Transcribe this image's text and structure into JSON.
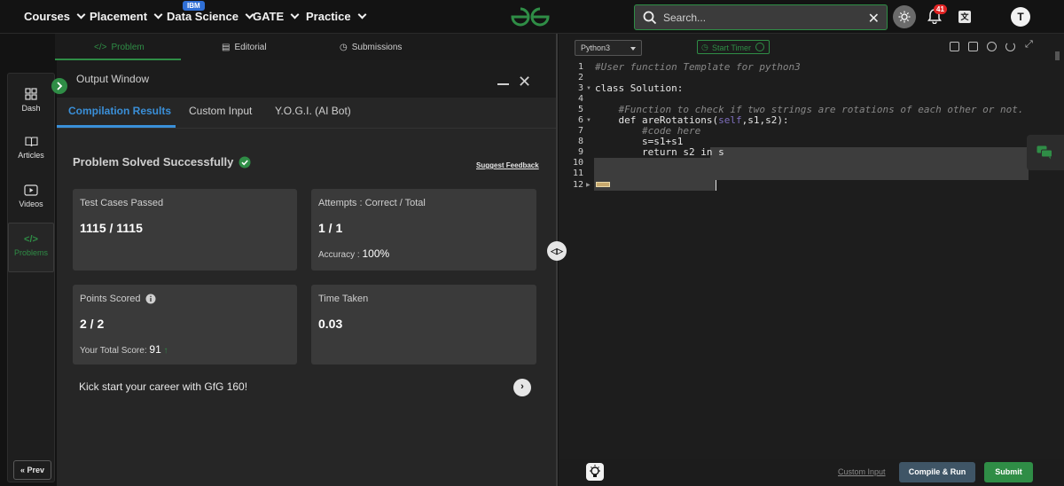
{
  "nav": {
    "courses": "Courses",
    "placement": "Placement",
    "data_science": "Data Science",
    "ibm_badge": "IBM",
    "gate": "GATE",
    "practice": "Practice"
  },
  "search": {
    "placeholder": "Search..."
  },
  "notifications": {
    "count": "41"
  },
  "user": {
    "initial": "T"
  },
  "problem_tabs": {
    "problem": "Problem",
    "editorial": "Editorial",
    "submissions": "Submissions"
  },
  "sidebar": {
    "dash": "Dash",
    "articles": "Articles",
    "videos": "Videos",
    "problems": "Problems",
    "prev": "Prev"
  },
  "output": {
    "title": "Output Window",
    "tabs": [
      "Compilation Results",
      "Custom Input",
      "Y.O.G.I. (AI Bot)"
    ],
    "status": "Problem Solved Successfully",
    "feedback": "Suggest Feedback",
    "cards": {
      "test_cases": {
        "label": "Test Cases Passed",
        "value": "1115 / 1115"
      },
      "attempts": {
        "label": "Attempts : Correct / Total",
        "value": "1 / 1",
        "accuracy_label": "Accuracy :",
        "accuracy_value": "100%"
      },
      "points": {
        "label": "Points Scored",
        "value": "2 / 2",
        "total_label": "Your Total Score:",
        "total_value": "91"
      },
      "time": {
        "label": "Time Taken",
        "value": "0.03"
      }
    },
    "promo": "Kick start your career with GfG 160!"
  },
  "editor": {
    "language": "Python3",
    "timer": "Start Timer",
    "line_numbers": [
      "1",
      "2",
      "3",
      "4",
      "5",
      "6",
      "7",
      "8",
      "9",
      "10",
      "11",
      "12"
    ],
    "code": {
      "l1": "#User function Template for python3",
      "l3": "class Solution:",
      "l5": "    #Function to check if two strings are rotations of each other or not.",
      "l6_a": "    def areRotations(",
      "l6_self": "self",
      "l6_b": ",s1,s2):",
      "l7": "        #code here",
      "l8": "        s=s1+s1",
      "l9": "        return s2 in s"
    },
    "custom_input": "Custom Input",
    "compile": "Compile & Run",
    "submit": "Submit"
  },
  "colors": {
    "accent_green": "#2f8d46",
    "tab_blue": "#3a8fd8",
    "compile_bg": "#3f5566"
  }
}
